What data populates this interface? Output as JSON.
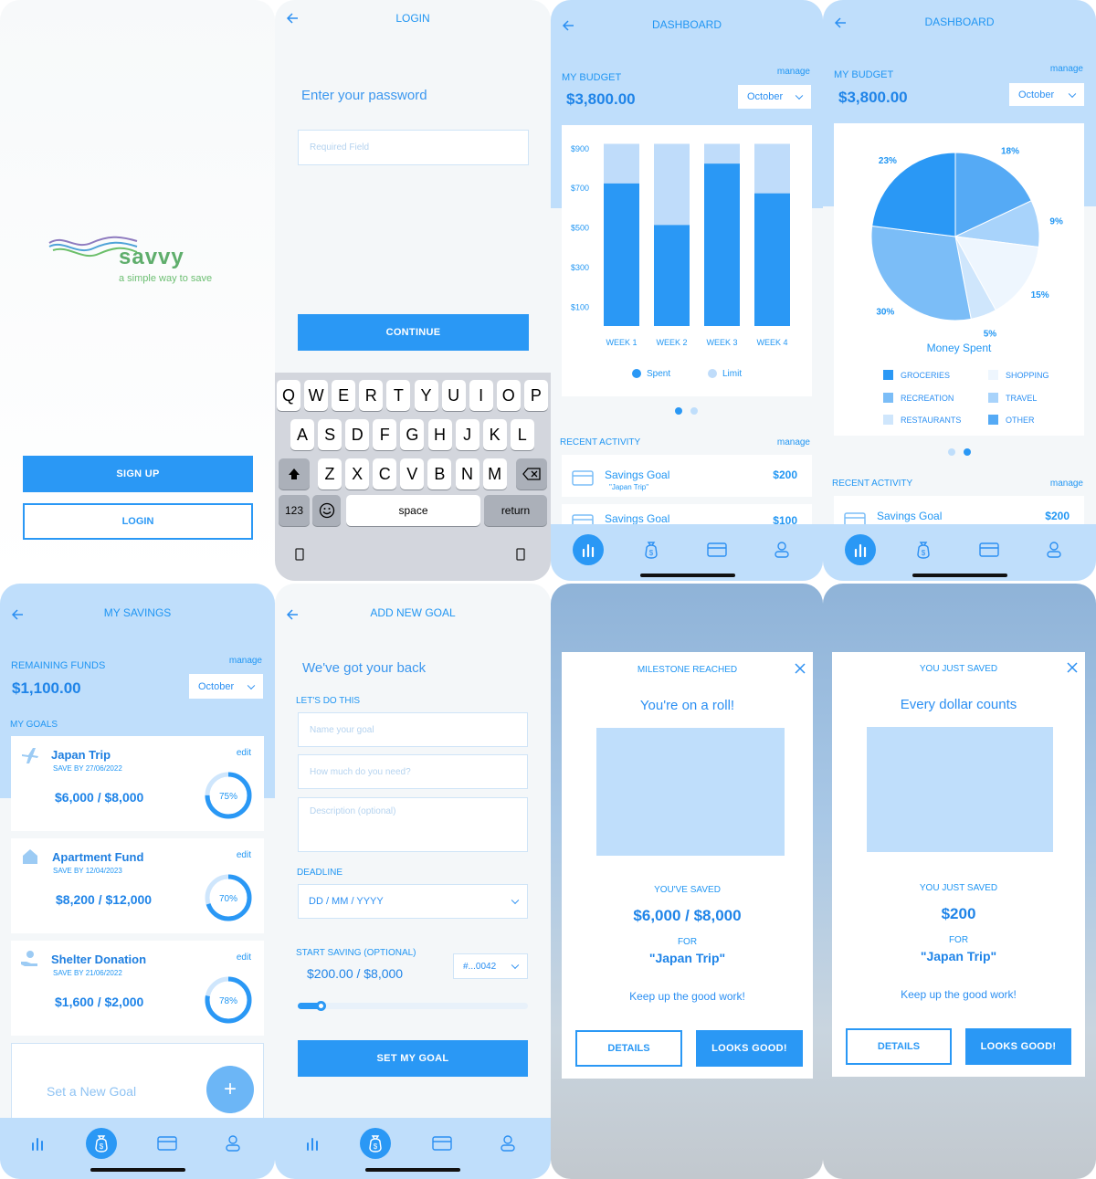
{
  "splash": {
    "brand": "savvy",
    "tagline": "a simple way to save",
    "signup_label": "SIGN UP",
    "login_label": "LOGIN"
  },
  "login": {
    "title": "LOGIN",
    "prompt": "Enter your password",
    "password_placeholder": "Required Field",
    "continue_label": "CONTINUE",
    "keyboard": {
      "row1": [
        "Q",
        "W",
        "E",
        "R",
        "T",
        "Y",
        "U",
        "I",
        "O",
        "P"
      ],
      "row2": [
        "A",
        "S",
        "D",
        "F",
        "G",
        "H",
        "J",
        "K",
        "L"
      ],
      "row3": [
        "Z",
        "X",
        "C",
        "V",
        "B",
        "N",
        "M"
      ],
      "numbers_label": "123",
      "space_label": "space",
      "return_label": "return"
    }
  },
  "dashboard_bar": {
    "title": "DASHBOARD",
    "budget_label": "MY BUDGET",
    "manage_label": "manage",
    "budget_amount": "$3,800.00",
    "month": "October",
    "recent_label": "RECENT ACTIVITY",
    "recent_manage": "manage",
    "activity": [
      {
        "title": "Savings Goal",
        "subtitle": "\"Japan Trip\"",
        "amount": "$200"
      },
      {
        "title": "Savings Goal",
        "subtitle": "",
        "amount": "$100"
      }
    ]
  },
  "dashboard_pie": {
    "title": "DASHBOARD",
    "budget_label": "MY BUDGET",
    "manage_label": "manage",
    "budget_amount": "$3,800.00",
    "month": "October",
    "recent_label": "RECENT ACTIVITY",
    "recent_manage": "manage",
    "activity": [
      {
        "title": "Savings Goal",
        "amount": "$200"
      }
    ]
  },
  "chart_data": [
    {
      "type": "bar",
      "categories": [
        "WEEK 1",
        "WEEK 2",
        "WEEK 3",
        "WEEK 4"
      ],
      "series": [
        {
          "name": "Spent",
          "values": [
            720,
            510,
            820,
            670
          ],
          "color": "#2a98f5"
        },
        {
          "name": "Limit",
          "values": [
            920,
            920,
            920,
            920
          ],
          "color": "#bfdcfa"
        }
      ],
      "y_ticks": [
        "$900",
        "$700",
        "$500",
        "$300",
        "$100"
      ],
      "ylim": [
        0,
        950
      ],
      "legend_position": "bottom"
    },
    {
      "type": "pie",
      "title": "Money Spent",
      "slices": [
        {
          "label": "18%",
          "value": 18,
          "color": "#55aaf5"
        },
        {
          "label": "9%",
          "value": 9,
          "color": "#a8d3fb"
        },
        {
          "label": "15%",
          "value": 15,
          "color": "#eef6fe"
        },
        {
          "label": "5%",
          "value": 5,
          "color": "#cfe6fc"
        },
        {
          "label": "30%",
          "value": 30,
          "color": "#7bbdf7"
        },
        {
          "label": "23%",
          "value": 23,
          "color": "#2a98f5"
        }
      ],
      "legend": [
        {
          "label": "GROCERIES",
          "color": "#2a98f5"
        },
        {
          "label": "SHOPPING",
          "color": "#eef6fe"
        },
        {
          "label": "RECREATION",
          "color": "#7bbdf7"
        },
        {
          "label": "TRAVEL",
          "color": "#a8d3fb"
        },
        {
          "label": "RESTAURANTS",
          "color": "#cfe6fc"
        },
        {
          "label": "OTHER",
          "color": "#55aaf5"
        }
      ]
    }
  ],
  "savings": {
    "title": "MY SAVINGS",
    "remaining_label": "REMAINING FUNDS",
    "manage_label": "manage",
    "remaining_amount": "$1,100.00",
    "month": "October",
    "goals_label": "MY GOALS",
    "goals": [
      {
        "name": "Japan Trip",
        "save_by": "SAVE BY 27/06/2022",
        "progress": "$6,000 / $8,000",
        "percent": "75%",
        "fraction": 0.75,
        "edit": "edit",
        "icon": "plane-icon"
      },
      {
        "name": "Apartment Fund",
        "save_by": "SAVE BY 12/04/2023",
        "progress": "$8,200 / $12,000",
        "percent": "70%",
        "fraction": 0.7,
        "edit": "edit",
        "icon": "house-icon"
      },
      {
        "name": "Shelter Donation",
        "save_by": "SAVE BY 21/06/2022",
        "progress": "$1,600 / $2,000",
        "percent": "78%",
        "fraction": 0.78,
        "edit": "edit",
        "icon": "donation-icon"
      }
    ],
    "new_goal_label": "Set a New Goal",
    "new_goal_symbol": "+"
  },
  "add_goal": {
    "title": "ADD NEW GOAL",
    "headline": "We've got your back",
    "section_label": "LET'S DO THIS",
    "name_placeholder": "Name your goal",
    "amount_placeholder": "How much do you need?",
    "description_placeholder": "Description (optional)",
    "deadline_label": "DEADLINE",
    "deadline_value": "DD / MM / YYYY",
    "start_label": "START SAVING (OPTIONAL)",
    "start_amount": "$200.00 / $8,000",
    "account": "#...0042",
    "slider_fraction": 0.1,
    "submit_label": "SET MY GOAL"
  },
  "milestone": {
    "title": "MILESTONE REACHED",
    "headline": "You're on a roll!",
    "saved_label": "YOU'VE SAVED",
    "saved_amount": "$6,000 / $8,000",
    "for_label": "FOR",
    "goal_name": "\"Japan Trip\"",
    "message": "Keep up the good work!",
    "details_label": "DETAILS",
    "ok_label": "LOOKS GOOD!"
  },
  "just_saved": {
    "title": "YOU JUST SAVED",
    "headline": "Every dollar counts",
    "saved_label": "YOU JUST SAVED",
    "saved_amount": "$200",
    "for_label": "FOR",
    "goal_name": "\"Japan Trip\"",
    "message": "Keep up the good work!",
    "details_label": "DETAILS",
    "ok_label": "LOOKS GOOD!"
  }
}
